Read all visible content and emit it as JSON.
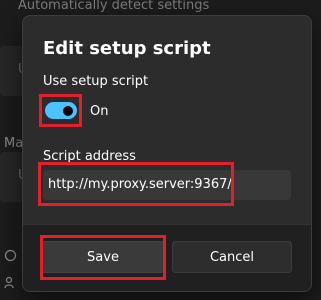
{
  "background": {
    "heading": "Automatically detect settings",
    "card1_letter": "U",
    "section_letters": "Ma",
    "card2_letter": "U"
  },
  "dialog": {
    "title": "Edit setup script",
    "toggle": {
      "label": "Use setup script",
      "state": "On",
      "on": true
    },
    "script_address": {
      "label": "Script address",
      "value": "http://my.proxy.server:9367/"
    },
    "buttons": {
      "save": "Save",
      "cancel": "Cancel"
    }
  },
  "colors": {
    "accent": "#4cc2ff",
    "highlight": "#e0202c"
  }
}
